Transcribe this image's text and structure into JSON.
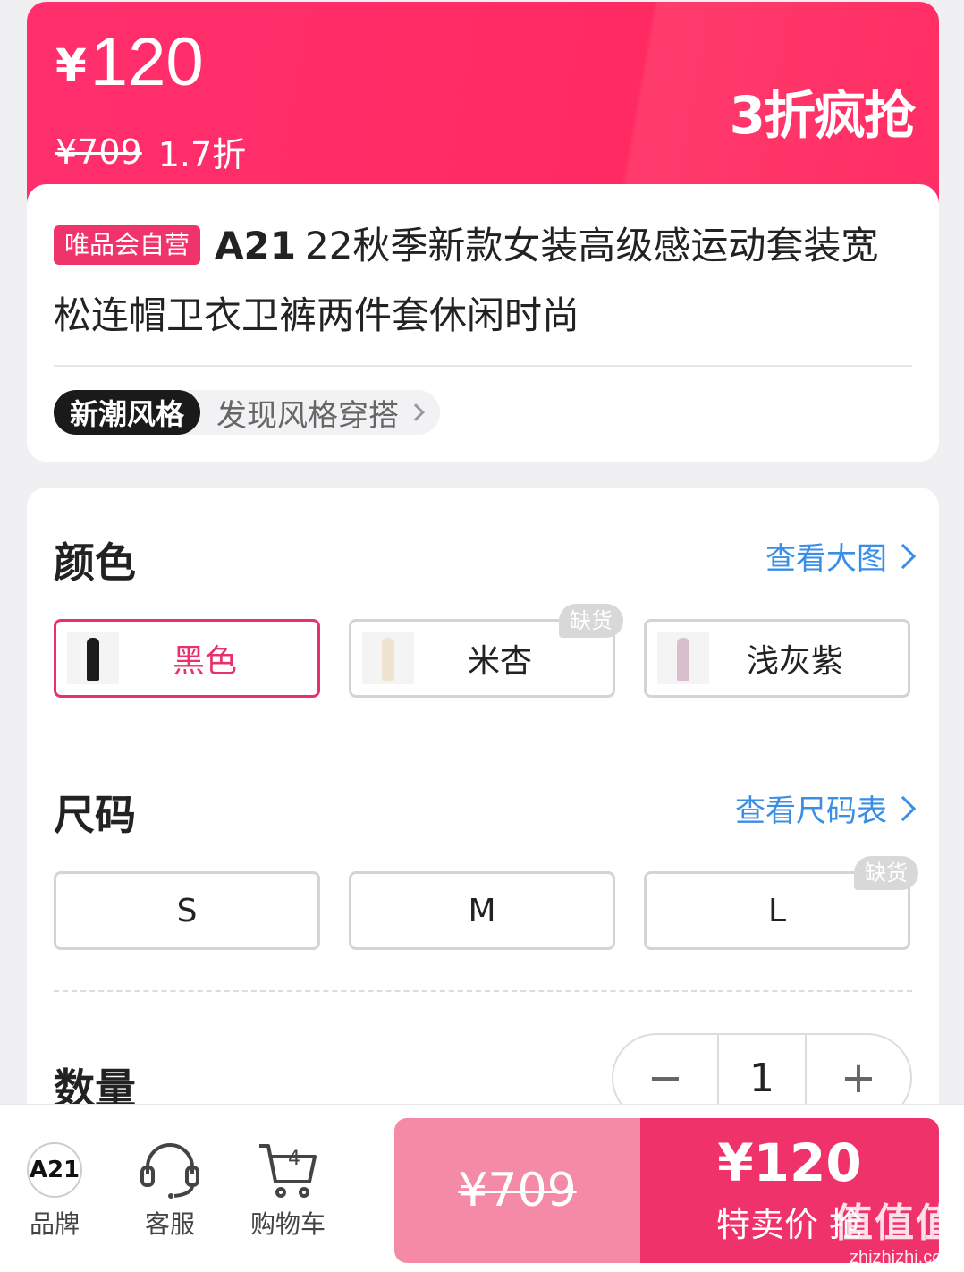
{
  "price_banner": {
    "currency": "¥",
    "price": "120",
    "original_price": "¥709",
    "discount": "1.7折",
    "promo": "3折疯抢"
  },
  "product": {
    "tag": "唯品会自营",
    "brand": "A21",
    "title": "22秋季新款女装高级感运动套装宽松连帽卫衣卫裤两件套休闲时尚",
    "style_badge": "新潮风格",
    "style_link": "发现风格穿搭"
  },
  "color": {
    "title": "颜色",
    "link": "查看大图",
    "options": [
      {
        "label": "黑色",
        "selected": true,
        "out_of_stock": false,
        "swatch": "#1b1b1b"
      },
      {
        "label": "米杏",
        "selected": false,
        "out_of_stock": true,
        "swatch": "#efe4d2"
      },
      {
        "label": "浅灰紫",
        "selected": false,
        "out_of_stock": false,
        "swatch": "#d9bfcc"
      }
    ],
    "oos_label": "缺货"
  },
  "size": {
    "title": "尺码",
    "link": "查看尺码表",
    "options": [
      {
        "label": "S",
        "out_of_stock": false
      },
      {
        "label": "M",
        "out_of_stock": false
      },
      {
        "label": "L",
        "out_of_stock": true
      }
    ],
    "oos_label": "缺货"
  },
  "quantity": {
    "title": "数量",
    "minus": "−",
    "value": "1",
    "plus": "+"
  },
  "bottom_nav": {
    "brand_logo": "A21",
    "brand_label": "品牌",
    "service_label": "客服",
    "cart_label": "购物车",
    "cart_count": "4"
  },
  "buy": {
    "original_price": "¥709",
    "price": "¥120",
    "label": "特卖价 抢"
  },
  "watermark": {
    "big": "值值值",
    "small": "zhizhizhi.com"
  },
  "colors": {
    "accent": "#ef336a",
    "link": "#3a8ee6"
  }
}
